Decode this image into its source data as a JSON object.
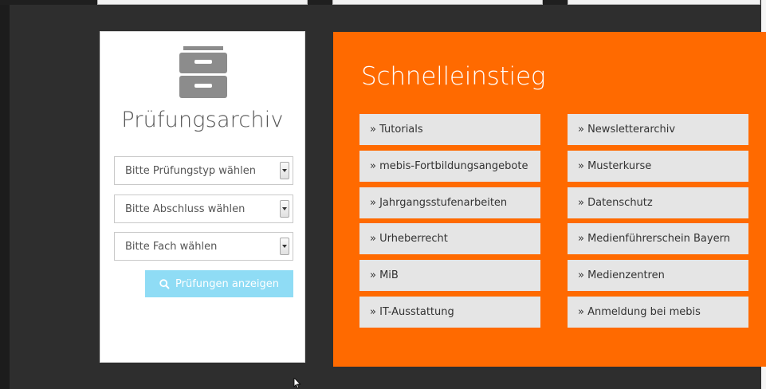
{
  "archive": {
    "title": "Prüfungsarchiv",
    "icon": "filing-cabinet-icon",
    "selects": [
      {
        "label": "Bitte Prüfungstyp wählen"
      },
      {
        "label": "Bitte Abschluss wählen"
      },
      {
        "label": "Bitte Fach wählen"
      }
    ],
    "button_label": "Prüfungen anzeigen"
  },
  "quick": {
    "title": "Schnelleinstieg",
    "left_links": [
      "» Tutorials",
      "» mebis-Fortbildungsangebote",
      "» Jahrgangsstufenarbeiten",
      "» Urheberrecht",
      "» MiB",
      "» IT-Ausstattung"
    ],
    "right_links": [
      "» Newsletterarchiv",
      "» Musterkurse",
      "» Datenschutz",
      "» Medienführerschein Bayern",
      "» Medienzentren",
      "» Anmeldung bei mebis"
    ]
  },
  "colors": {
    "page_background": "#2e2e2e",
    "quick_panel": "#ff6a00",
    "link_tile": "#e5e5e5",
    "button": "#8fdcf5"
  }
}
